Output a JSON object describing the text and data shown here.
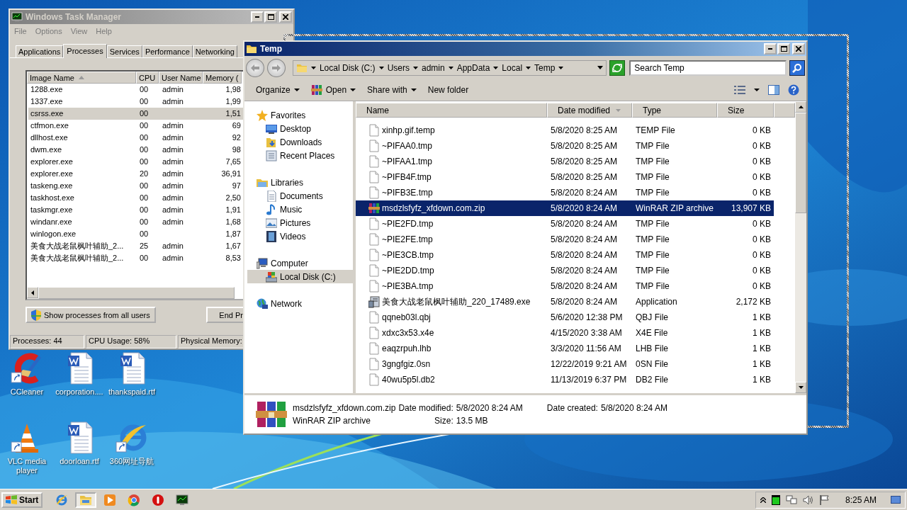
{
  "task_manager": {
    "title": "Windows Task Manager",
    "menu": [
      "File",
      "Options",
      "View",
      "Help"
    ],
    "tabs": [
      {
        "label": "Applications",
        "selected": false
      },
      {
        "label": "Processes",
        "selected": true
      },
      {
        "label": "Services",
        "selected": false
      },
      {
        "label": "Performance",
        "selected": false
      },
      {
        "label": "Networking",
        "selected": false
      }
    ],
    "columns": [
      "Image Name",
      "CPU",
      "User Name",
      "Memory ("
    ],
    "processes": [
      {
        "name": "1288.exe",
        "cpu": "00",
        "user": "admin",
        "memory": "1,98",
        "selected": false
      },
      {
        "name": "1337.exe",
        "cpu": "00",
        "user": "admin",
        "memory": "1,99",
        "selected": false
      },
      {
        "name": "csrss.exe",
        "cpu": "00",
        "memory": "1,51",
        "selected": true
      },
      {
        "name": "ctfmon.exe",
        "cpu": "00",
        "user": "admin",
        "memory": "69",
        "selected": false
      },
      {
        "name": "dllhost.exe",
        "cpu": "00",
        "user": "admin",
        "memory": "92",
        "selected": false
      },
      {
        "name": "dwm.exe",
        "cpu": "00",
        "user": "admin",
        "memory": "98",
        "selected": false
      },
      {
        "name": "explorer.exe",
        "cpu": "00",
        "user": "admin",
        "memory": "7,65",
        "selected": false
      },
      {
        "name": "explorer.exe",
        "cpu": "20",
        "user": "admin",
        "memory": "36,91",
        "selected": false
      },
      {
        "name": "taskeng.exe",
        "cpu": "00",
        "user": "admin",
        "memory": "97",
        "selected": false
      },
      {
        "name": "taskhost.exe",
        "cpu": "00",
        "user": "admin",
        "memory": "2,50",
        "selected": false
      },
      {
        "name": "taskmgr.exe",
        "cpu": "00",
        "user": "admin",
        "memory": "1,91",
        "selected": false
      },
      {
        "name": "windanr.exe",
        "cpu": "00",
        "user": "admin",
        "memory": "1,68",
        "selected": false
      },
      {
        "name": "winlogon.exe",
        "cpu": "00",
        "memory": "1,87",
        "selected": false
      },
      {
        "name": "美食大战老鼠枫叶辅助_2...",
        "cpu": "25",
        "user": "admin",
        "memory": "1,67",
        "selected": false
      },
      {
        "name": "美食大战老鼠枫叶辅助_2...",
        "cpu": "00",
        "user": "admin",
        "memory": "8,53",
        "selected": false
      }
    ],
    "show_all_button": "Show processes from all users",
    "end_button": "End Pr",
    "status_bar": [
      "Processes: 44",
      "CPU Usage: 58%",
      "Physical Memory:"
    ]
  },
  "explorer": {
    "title": "Temp",
    "breadcrumb": [
      "Local Disk (C:)",
      "Users",
      "admin",
      "AppData",
      "Local",
      "Temp"
    ],
    "search": {
      "placeholder": "Search Temp"
    },
    "toolbar": [
      {
        "label": "Organize",
        "kind": "menu"
      },
      {
        "label": "Open",
        "kind": "open"
      },
      {
        "label": "Share with",
        "kind": "menu"
      },
      {
        "label": "New folder",
        "kind": "plain"
      }
    ],
    "sidebar": [
      {
        "label": "Favorites",
        "kind": "favorites",
        "selected": false,
        "children": [
          {
            "label": "Desktop",
            "kind": "desktop",
            "selected": false
          },
          {
            "label": "Downloads",
            "kind": "downloads",
            "selected": false
          },
          {
            "label": "Recent Places",
            "kind": "recent",
            "selected": false
          }
        ]
      },
      {
        "label": "Libraries",
        "kind": "libraries",
        "selected": false,
        "children": [
          {
            "label": "Documents",
            "kind": "documents",
            "selected": false
          },
          {
            "label": "Music",
            "kind": "music",
            "selected": false
          },
          {
            "label": "Pictures",
            "kind": "pictures",
            "selected": false
          },
          {
            "label": "Videos",
            "kind": "videos",
            "selected": false
          }
        ]
      },
      {
        "label": "Computer",
        "kind": "computer",
        "selected": false,
        "children": [
          {
            "label": "Local Disk (C:)",
            "kind": "drive",
            "selected": true
          }
        ]
      },
      {
        "label": "Network",
        "kind": "network",
        "selected": false
      }
    ],
    "columns": [
      "Name",
      "Date modified",
      "Type",
      "Size"
    ],
    "files": [
      {
        "name": "xinhp.gif.temp",
        "date": "5/8/2020 8:25 AM",
        "type": "TEMP File",
        "size": "0 KB",
        "kind": "blank",
        "selected": false
      },
      {
        "name": "~PIFAA0.tmp",
        "date": "5/8/2020 8:25 AM",
        "type": "TMP File",
        "size": "0 KB",
        "kind": "blank",
        "selected": false
      },
      {
        "name": "~PIFAA1.tmp",
        "date": "5/8/2020 8:25 AM",
        "type": "TMP File",
        "size": "0 KB",
        "kind": "blank",
        "selected": false
      },
      {
        "name": "~PIFB4F.tmp",
        "date": "5/8/2020 8:25 AM",
        "type": "TMP File",
        "size": "0 KB",
        "kind": "blank",
        "selected": false
      },
      {
        "name": "~PIFB3E.tmp",
        "date": "5/8/2020 8:24 AM",
        "type": "TMP File",
        "size": "0 KB",
        "kind": "blank",
        "selected": false
      },
      {
        "name": "msdzlsfyfz_xfdown.com.zip",
        "date": "5/8/2020 8:24 AM",
        "type": "WinRAR ZIP archive",
        "size": "13,907 KB",
        "kind": "zip",
        "selected": true
      },
      {
        "name": "~PIE2FD.tmp",
        "date": "5/8/2020 8:24 AM",
        "type": "TMP File",
        "size": "0 KB",
        "kind": "blank",
        "selected": false
      },
      {
        "name": "~PIE2FE.tmp",
        "date": "5/8/2020 8:24 AM",
        "type": "TMP File",
        "size": "0 KB",
        "kind": "blank",
        "selected": false
      },
      {
        "name": "~PIE3CB.tmp",
        "date": "5/8/2020 8:24 AM",
        "type": "TMP File",
        "size": "0 KB",
        "kind": "blank",
        "selected": false
      },
      {
        "name": "~PIE2DD.tmp",
        "date": "5/8/2020 8:24 AM",
        "type": "TMP File",
        "size": "0 KB",
        "kind": "blank",
        "selected": false
      },
      {
        "name": "~PIE3BA.tmp",
        "date": "5/8/2020 8:24 AM",
        "type": "TMP File",
        "size": "0 KB",
        "kind": "blank",
        "selected": false
      },
      {
        "name": "美食大战老鼠枫叶辅助_220_17489.exe",
        "date": "5/8/2020 8:24 AM",
        "type": "Application",
        "size": "2,172 KB",
        "kind": "exe",
        "selected": false
      },
      {
        "name": "qqneb03l.qbj",
        "date": "5/6/2020 12:38 PM",
        "type": "QBJ File",
        "size": "1 KB",
        "kind": "blank",
        "selected": false
      },
      {
        "name": "xdxc3x53.x4e",
        "date": "4/15/2020 3:38 AM",
        "type": "X4E File",
        "size": "1 KB",
        "kind": "blank",
        "selected": false
      },
      {
        "name": "eaqzrpuh.lhb",
        "date": "3/3/2020 11:56 AM",
        "type": "LHB File",
        "size": "1 KB",
        "kind": "blank",
        "selected": false
      },
      {
        "name": "3gngfgiz.0sn",
        "date": "12/22/2019 9:21 AM",
        "type": "0SN File",
        "size": "1 KB",
        "kind": "blank",
        "selected": false
      },
      {
        "name": "40wu5p5l.db2",
        "date": "11/13/2019 6:37 PM",
        "type": "DB2 File",
        "size": "1 KB",
        "kind": "blank",
        "selected": false
      }
    ],
    "details": {
      "name": "msdzlsfyfz_xfdown.com.zip",
      "type": "WinRAR ZIP archive",
      "fields": [
        {
          "label": "Date modified:",
          "value": "5/8/2020 8:24 AM"
        },
        {
          "label": "Size:",
          "value": "13.5 MB"
        },
        {
          "label": "Date created:",
          "value": "5/8/2020 8:24 AM"
        }
      ]
    }
  },
  "desktop_icons": [
    {
      "label": "CCleaner",
      "kind": "ccleaner"
    },
    {
      "label": "corporation....",
      "kind": "word"
    },
    {
      "label": "thankspaid.rtf",
      "kind": "word"
    },
    {
      "label": "VLC media player",
      "kind": "vlc"
    },
    {
      "label": "doorloan.rtf",
      "kind": "word"
    },
    {
      "label": "360网址导航",
      "kind": "ie"
    }
  ],
  "taskbar": {
    "start": "Start",
    "apps": [
      {
        "kind": "ie",
        "active": false
      },
      {
        "kind": "explorer",
        "active": true
      },
      {
        "kind": "media",
        "active": false
      },
      {
        "kind": "chrome",
        "active": false
      },
      {
        "kind": "redcircle",
        "active": false
      },
      {
        "kind": "taskmgr",
        "active": false
      }
    ],
    "clock": "8:25 AM"
  }
}
